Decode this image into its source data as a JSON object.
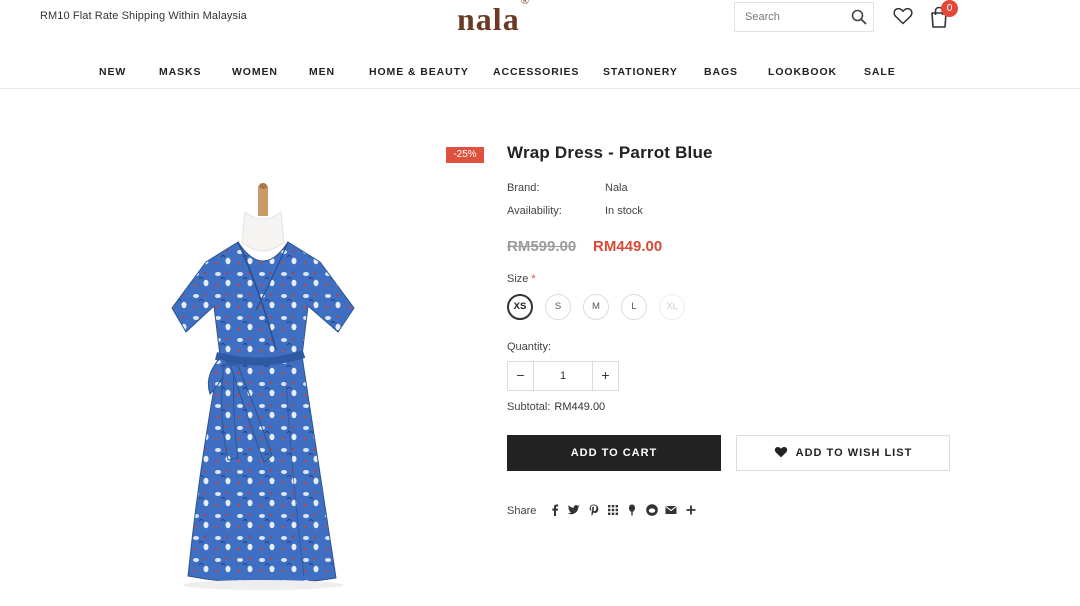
{
  "header": {
    "shipping_text": "RM10 Flat Rate Shipping Within Malaysia",
    "logo_text": "nala",
    "logo_mark": "®",
    "search_placeholder": "Search",
    "cart_count": "0",
    "icons": [
      "search-icon",
      "heart-icon",
      "shopping-bag-icon"
    ],
    "badge_color": "#e3483a",
    "logo_color": "#6b3a24"
  },
  "nav": {
    "items": [
      "NEW",
      "MASKS",
      "WOMEN",
      "MEN",
      "HOME & BEAUTY",
      "ACCESSORIES",
      "STATIONERY",
      "BAGS",
      "LOOKBOOK",
      "SALE"
    ]
  },
  "product": {
    "discount_badge": "-25%",
    "title": "Wrap Dress - Parrot Blue",
    "brand_label": "Brand:",
    "brand_value": "Nala",
    "availability_label": "Availability:",
    "availability_value": "In stock",
    "old_price": "RM599.00",
    "new_price": "RM449.00",
    "size_label": "Size",
    "size_required_mark": "*",
    "sizes": [
      "XS",
      "S",
      "M",
      "L",
      "XL"
    ],
    "selected_size": "XS",
    "unavailable_sizes": [
      "XL"
    ],
    "quantity_label": "Quantity:",
    "quantity_value": "1",
    "qty_minus": "−",
    "qty_plus": "+",
    "subtotal_label": "Subtotal:",
    "subtotal_value": "RM449.00",
    "add_to_cart_label": "ADD TO CART",
    "add_to_wishlist_label": "ADD TO WISH LIST",
    "share_label": "Share",
    "share_icons": [
      "facebook-icon",
      "twitter-icon",
      "pinterest-icon",
      "grid-icon",
      "tumblr-icon",
      "reddit-icon",
      "email-icon",
      "more-icon"
    ],
    "price_color": "#d74a38",
    "badge_color": "#e0503f"
  }
}
